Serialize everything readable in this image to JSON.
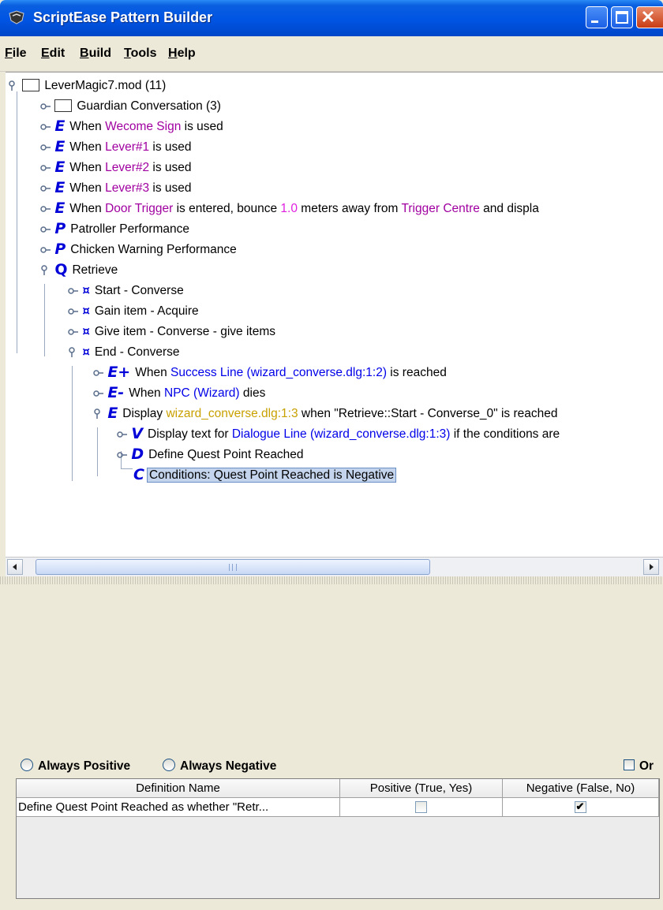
{
  "window": {
    "title": "ScriptEase Pattern Builder"
  },
  "menu": [
    {
      "mnemonic": "F",
      "rest": "ile"
    },
    {
      "mnemonic": "E",
      "rest": "dit"
    },
    {
      "mnemonic": "B",
      "rest": "uild"
    },
    {
      "mnemonic": "T",
      "rest": "ools"
    },
    {
      "mnemonic": "H",
      "rest": "elp"
    }
  ],
  "tree": {
    "root": "LeverMagic7.mod (11)",
    "guardian": "Guardian Conversation (3)",
    "welcome": {
      "pre": "When ",
      "obj": "Wecome Sign",
      "post": " is used"
    },
    "lever1": {
      "pre": "When ",
      "obj": "Lever#1",
      "post": " is used"
    },
    "lever2": {
      "pre": "When ",
      "obj": "Lever#2",
      "post": " is used"
    },
    "lever3": {
      "pre": "When ",
      "obj": "Lever#3",
      "post": " is used"
    },
    "door": {
      "pre": "When ",
      "obj": "Door Trigger",
      "mid1": " is entered, bounce ",
      "num": "1.0",
      "mid2": " meters away from ",
      "obj2": "Trigger Centre",
      "post": " and displa"
    },
    "patroller": "Patroller Performance",
    "chicken": "Chicken Warning Performance",
    "retrieve": "Retrieve",
    "start": "Start - Converse",
    "gain": "Gain item - Acquire",
    "give": "Give item - Converse - give items",
    "end": "End - Converse",
    "success": {
      "pre": "When ",
      "obj": "Success Line (wizard_converse.dlg:1:2)",
      "post": " is reached"
    },
    "npc": {
      "pre": "When ",
      "obj": "NPC (Wizard)",
      "post": " dies"
    },
    "display": {
      "pre": "Display ",
      "obj": "wizard_converse.dlg:1:3",
      "post": " when \"Retrieve::Start - Converse_0\" is reached"
    },
    "displaytext": {
      "pre": "Display text for ",
      "obj": "Dialogue Line (wizard_converse.dlg:1:3)",
      "post": " if the conditions are"
    },
    "define": "Define Quest Point Reached",
    "conditions": "Conditions: Quest Point Reached is Negative"
  },
  "icons": {
    "E": "E",
    "P": "P",
    "Q": "Q",
    "task": "¤",
    "Eplus": "E+",
    "Eminus": "E-",
    "V": "V",
    "D": "D",
    "C": "C"
  },
  "options": {
    "always_positive": "Always Positive",
    "always_negative": "Always Negative",
    "or_label": "Or",
    "always_positive_checked": false,
    "always_negative_checked": false,
    "or_checked": false
  },
  "table": {
    "headers": [
      "Definition Name",
      "Positive (True, Yes)",
      "Negative (False, No)"
    ],
    "rows": [
      {
        "name": "Define Quest Point Reached as whether \"Retr...",
        "positive": false,
        "negative": true
      }
    ],
    "check_mark": "✔"
  },
  "colors": {
    "titlebar": "#0054e3",
    "object": "#a000a0",
    "link": "#0000e8",
    "number": "#c8a000",
    "icon": "#0000d8"
  }
}
